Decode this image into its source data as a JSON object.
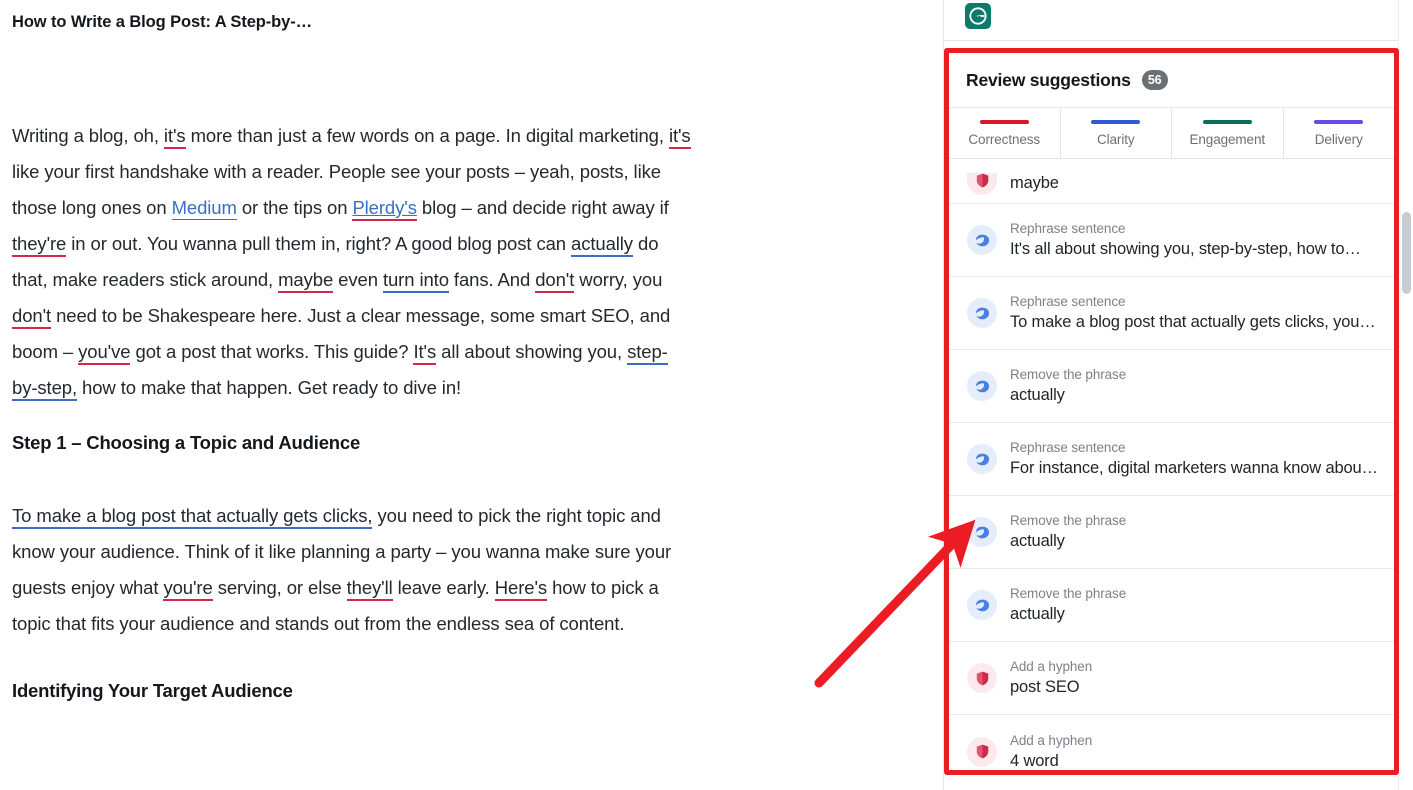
{
  "document": {
    "title": "How to Write a Blog Post: A Step-by-…",
    "paragraph1": {
      "seg1": "Writing a blog, oh, ",
      "mark1": "it's",
      "seg2": " more than just a few words on a page. In digital marketing, ",
      "mark2": "it's",
      "seg3": " like your first handshake with a reader. People see your posts – yeah, posts, like those long ones on ",
      "link1": "Medium",
      "seg4": " or the tips on ",
      "link2": "Plerdy's",
      "seg5": " blog – and decide right away if ",
      "mark3": "they're",
      "seg6": " in or out. You wanna pull them in, right? A good blog post can ",
      "mark4": "actually",
      "seg7": " do that, make readers stick around, ",
      "mark5": "maybe",
      "seg8": " even ",
      "mark6": "turn into",
      "seg9": " fans. And ",
      "mark7": "don't",
      "seg10": " worry, you ",
      "mark8": "don't",
      "seg11": " need to be Shakespeare here. Just a clear message, some smart SEO, and boom – ",
      "mark9": "you've",
      "seg12": " got a post that works. This guide? ",
      "mark10": "It's",
      "seg13": " all about showing you, ",
      "mark11": "step-by-step,",
      "seg14": " how to make that happen. Get ready to dive in!"
    },
    "heading1": "Step 1 – Choosing a Topic and Audience",
    "paragraph2": {
      "mark1": "To make a blog post that actually gets clicks,",
      "seg1": " you need to pick the right topic and know your audience. Think of it like planning a party – you wanna make sure your guests enjoy what ",
      "mark2": "you're",
      "seg2": " serving, or else ",
      "mark3": "they'll",
      "seg3": " leave early. ",
      "mark4": "Here's",
      "seg4": " how to pick a topic that fits your audience and stands out from the endless sea of content."
    },
    "heading2": "Identifying Your Target Audience"
  },
  "sidebar": {
    "logo_name": "grammarly-logo",
    "panel_title": "Review suggestions",
    "suggestion_count": "56",
    "tabs": [
      {
        "label": "Correctness",
        "color": "#d6182a"
      },
      {
        "label": "Clarity",
        "color": "#2e5bd4"
      },
      {
        "label": "Engagement",
        "color": "#0d6d5c"
      },
      {
        "label": "Delivery",
        "color": "#6b4ae0"
      }
    ],
    "suggestions": [
      {
        "category": "",
        "text": "maybe",
        "type": "correctness",
        "partial": true
      },
      {
        "category": "Rephrase sentence",
        "text": "It's all about showing you, step-by-step, how to…",
        "type": "clarity",
        "partial": false
      },
      {
        "category": "Rephrase sentence",
        "text": "To make a blog post that actually gets clicks, you…",
        "type": "clarity",
        "partial": false
      },
      {
        "category": "Remove the phrase",
        "text": "actually",
        "type": "clarity",
        "partial": false
      },
      {
        "category": "Rephrase sentence",
        "text": "For instance, digital marketers wanna know abou…",
        "type": "clarity",
        "partial": false
      },
      {
        "category": "Remove the phrase",
        "text": "actually",
        "type": "clarity",
        "partial": false
      },
      {
        "category": "Remove the phrase",
        "text": "actually",
        "type": "clarity",
        "partial": false
      },
      {
        "category": "Add a hyphen",
        "text": "post SEO",
        "type": "correctness",
        "partial": false
      },
      {
        "category": "Add a hyphen",
        "text": "4 word",
        "type": "correctness",
        "partial": false
      }
    ]
  },
  "annotation": {
    "box_color": "#ec1c24",
    "arrow_color": "#ec1c24"
  },
  "colors": {
    "correctness_underline": "#cf2a4d",
    "clarity_underline": "#3d6ec4",
    "link": "#3d6ec4",
    "brand_green": "#0d7a6b"
  }
}
